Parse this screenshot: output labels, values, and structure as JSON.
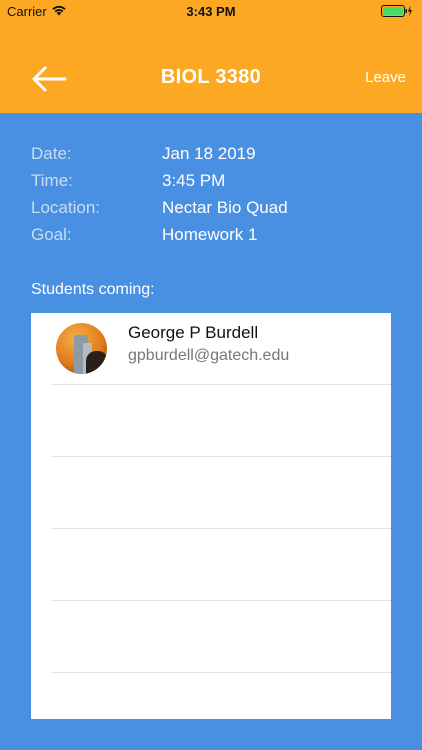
{
  "status_bar": {
    "carrier": "Carrier",
    "time": "3:43 PM"
  },
  "header": {
    "title": "BIOL 3380",
    "leave_label": "Leave",
    "back_icon": "arrow-left-icon"
  },
  "details": [
    {
      "label": "Date:",
      "value": "Jan 18 2019"
    },
    {
      "label": "Time:",
      "value": "3:45 PM"
    },
    {
      "label": "Location:",
      "value": "Nectar Bio Quad"
    },
    {
      "label": "Goal:",
      "value": "Homework 1"
    }
  ],
  "students": {
    "heading": "Students coming:",
    "items": [
      {
        "name": "George P Burdell",
        "email": "gpburdell@gatech.edu"
      }
    ]
  },
  "colors": {
    "header": "#fda822",
    "background": "#4a90e2",
    "panel": "#ffffff"
  }
}
